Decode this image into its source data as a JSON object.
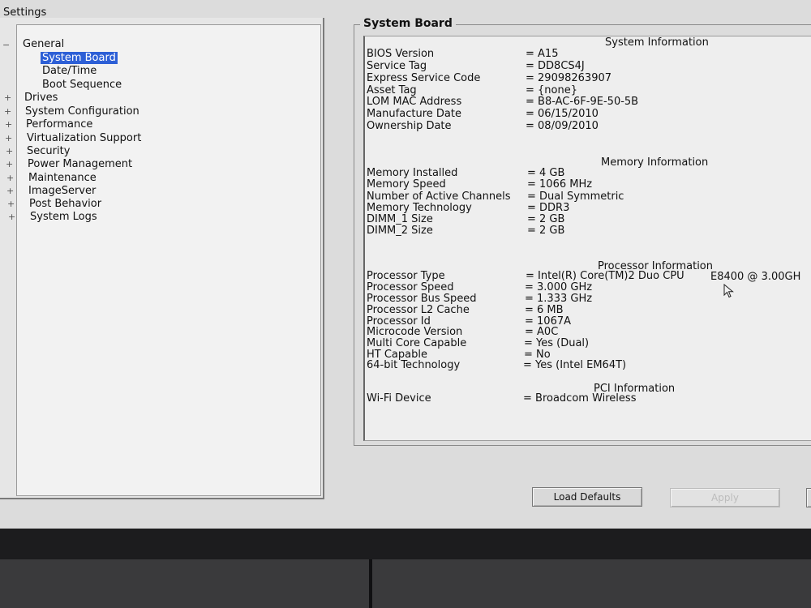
{
  "tree": {
    "title": "Settings",
    "items": [
      {
        "label": "General",
        "toggle": "−"
      },
      {
        "label": "System Board",
        "toggle": ""
      },
      {
        "label": "Date/Time",
        "toggle": ""
      },
      {
        "label": "Boot Sequence",
        "toggle": ""
      },
      {
        "label": "Drives",
        "toggle": "+"
      },
      {
        "label": "System Configuration",
        "toggle": "+"
      },
      {
        "label": "Performance",
        "toggle": "+"
      },
      {
        "label": "Virtualization Support",
        "toggle": "+"
      },
      {
        "label": "Security",
        "toggle": "+"
      },
      {
        "label": "Power Management",
        "toggle": "+"
      },
      {
        "label": "Maintenance",
        "toggle": "+"
      },
      {
        "label": "ImageServer",
        "toggle": "+"
      },
      {
        "label": "Post Behavior",
        "toggle": "+"
      },
      {
        "label": "System Logs",
        "toggle": "+"
      }
    ]
  },
  "panel": {
    "title": "System Board",
    "system": {
      "heading": "System Information",
      "rows": [
        {
          "label": "BIOS Version",
          "value": "= A15"
        },
        {
          "label": "Service Tag",
          "value": "= DD8CS4J"
        },
        {
          "label": "Express Service Code",
          "value": "= 29098263907"
        },
        {
          "label": "Asset Tag",
          "value": "= {none}"
        },
        {
          "label": "LOM MAC Address",
          "value": "= B8-AC-6F-9E-50-5B"
        },
        {
          "label": "Manufacture Date",
          "value": "= 06/15/2010"
        },
        {
          "label": "Ownership Date",
          "value": "= 08/09/2010"
        }
      ]
    },
    "memory": {
      "heading": "Memory Information",
      "rows": [
        {
          "label": "Memory Installed",
          "value": "= 4 GB"
        },
        {
          "label": "Memory Speed",
          "value": "= 1066 MHz"
        },
        {
          "label": "Number of Active Channels",
          "value": "= Dual Symmetric"
        },
        {
          "label": "Memory Technology",
          "value": "= DDR3"
        },
        {
          "label": "DIMM_1 Size",
          "value": "= 2 GB"
        },
        {
          "label": "DIMM_2 Size",
          "value": "= 2 GB"
        }
      ]
    },
    "processor": {
      "heading": "Processor Information",
      "extra": "E8400  @ 3.00GH",
      "rows": [
        {
          "label": "Processor Type",
          "value": "= Intel(R) Core(TM)2 Duo CPU"
        },
        {
          "label": "Processor Speed",
          "value": "= 3.000 GHz"
        },
        {
          "label": "Processor Bus Speed",
          "value": "= 1.333 GHz"
        },
        {
          "label": "Processor L2 Cache",
          "value": "= 6 MB"
        },
        {
          "label": "Processor Id",
          "value": "= 1067A"
        },
        {
          "label": "Microcode Version",
          "value": "= A0C"
        },
        {
          "label": "Multi Core Capable",
          "value": "= Yes (Dual)"
        },
        {
          "label": "HT Capable",
          "value": "= No"
        },
        {
          "label": "64-bit Technology",
          "value": "= Yes (Intel EM64T)"
        }
      ]
    },
    "pci": {
      "heading": "PCI Information",
      "rows": [
        {
          "label": "Wi-Fi Device",
          "value": "= Broadcom Wireless"
        }
      ]
    }
  },
  "buttons": {
    "load_defaults": "Load Defaults",
    "apply": "Apply",
    "edge": ""
  },
  "colors": {
    "selection": "#2d5fd6",
    "screen_bg": "#dcdcdc"
  }
}
